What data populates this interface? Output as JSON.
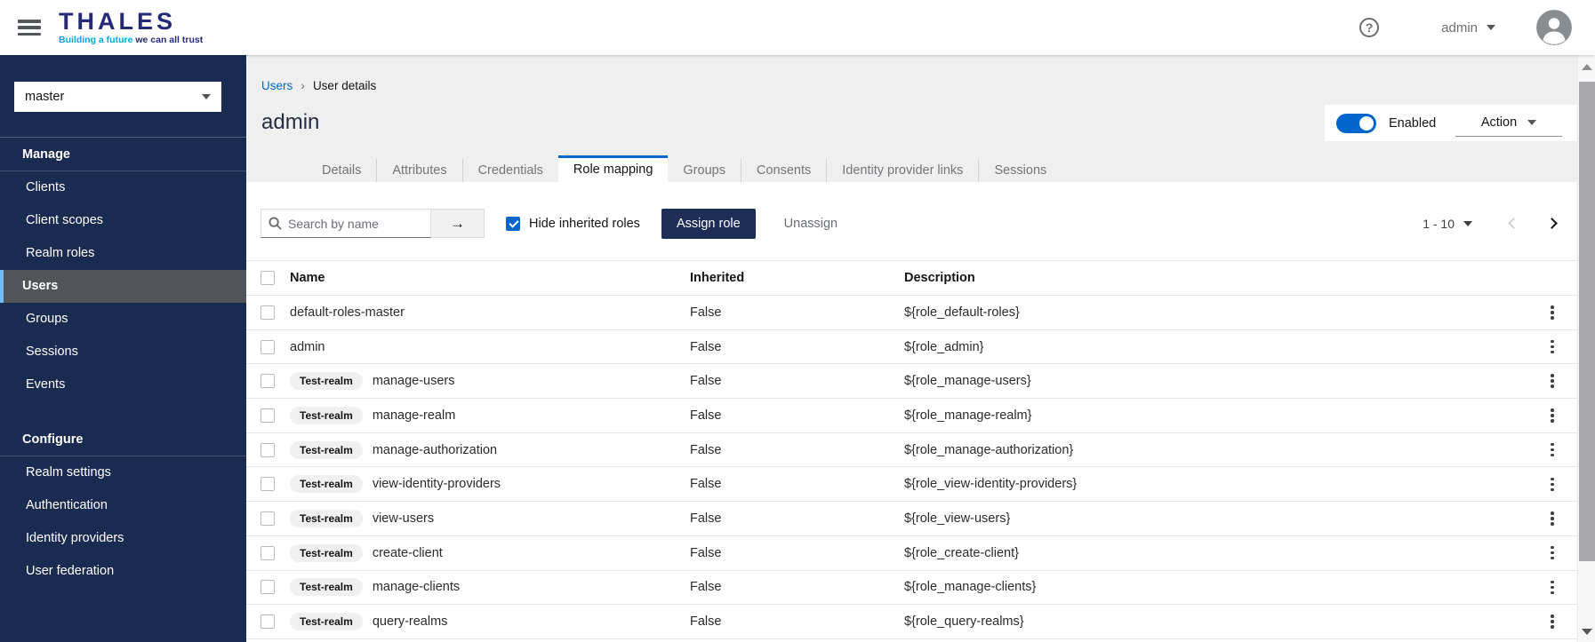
{
  "colors": {
    "accent": "#0066cc",
    "sidebar_bg": "#1a2b52",
    "navy_button": "#1e2d55",
    "brand_navy": "#242a75",
    "brand_cyan": "#00a9e0",
    "active_item_border": "#73bcf7"
  },
  "topbar": {
    "brand_name": "THALES",
    "brand_tagline_highlight": "Building a future",
    "brand_tagline_rest": " we can all trust",
    "help_icon": "question-circle-icon",
    "username": "admin"
  },
  "sidebar": {
    "realm": "master",
    "sections": [
      {
        "label": "Manage",
        "items": [
          {
            "label": "Clients",
            "active": false
          },
          {
            "label": "Client scopes",
            "active": false
          },
          {
            "label": "Realm roles",
            "active": false
          },
          {
            "label": "Users",
            "active": true
          },
          {
            "label": "Groups",
            "active": false
          },
          {
            "label": "Sessions",
            "active": false
          },
          {
            "label": "Events",
            "active": false
          }
        ]
      },
      {
        "label": "Configure",
        "items": [
          {
            "label": "Realm settings",
            "active": false
          },
          {
            "label": "Authentication",
            "active": false
          },
          {
            "label": "Identity providers",
            "active": false
          },
          {
            "label": "User federation",
            "active": false
          }
        ]
      }
    ]
  },
  "page": {
    "breadcrumb": [
      "Users",
      "User details"
    ],
    "title": "admin",
    "enabled_label": "Enabled",
    "enabled_state": "on",
    "action_label": "Action"
  },
  "tabs": [
    {
      "label": "Details",
      "active": false
    },
    {
      "label": "Attributes",
      "active": false
    },
    {
      "label": "Credentials",
      "active": false
    },
    {
      "label": "Role mapping",
      "active": true
    },
    {
      "label": "Groups",
      "active": false
    },
    {
      "label": "Consents",
      "active": false
    },
    {
      "label": "Identity provider links",
      "active": false
    },
    {
      "label": "Sessions",
      "active": false
    }
  ],
  "toolbar": {
    "search_placeholder": "Search by name",
    "hide_inherited_label": "Hide inherited roles",
    "hide_inherited_checked": true,
    "assign_label": "Assign role",
    "unassign_label": "Unassign",
    "pagination_range": "1 - 10"
  },
  "table": {
    "columns": [
      "Name",
      "Inherited",
      "Description"
    ],
    "rows": [
      {
        "badge": "",
        "name": "default-roles-master",
        "inherited": "False",
        "description": "${role_default-roles}"
      },
      {
        "badge": "",
        "name": "admin",
        "inherited": "False",
        "description": "${role_admin}"
      },
      {
        "badge": "Test-realm",
        "name": "manage-users",
        "inherited": "False",
        "description": "${role_manage-users}"
      },
      {
        "badge": "Test-realm",
        "name": "manage-realm",
        "inherited": "False",
        "description": "${role_manage-realm}"
      },
      {
        "badge": "Test-realm",
        "name": "manage-authorization",
        "inherited": "False",
        "description": "${role_manage-authorization}"
      },
      {
        "badge": "Test-realm",
        "name": "view-identity-providers",
        "inherited": "False",
        "description": "${role_view-identity-providers}"
      },
      {
        "badge": "Test-realm",
        "name": "view-users",
        "inherited": "False",
        "description": "${role_view-users}"
      },
      {
        "badge": "Test-realm",
        "name": "create-client",
        "inherited": "False",
        "description": "${role_create-client}"
      },
      {
        "badge": "Test-realm",
        "name": "manage-clients",
        "inherited": "False",
        "description": "${role_manage-clients}"
      },
      {
        "badge": "Test-realm",
        "name": "query-realms",
        "inherited": "False",
        "description": "${role_query-realms}"
      }
    ]
  }
}
